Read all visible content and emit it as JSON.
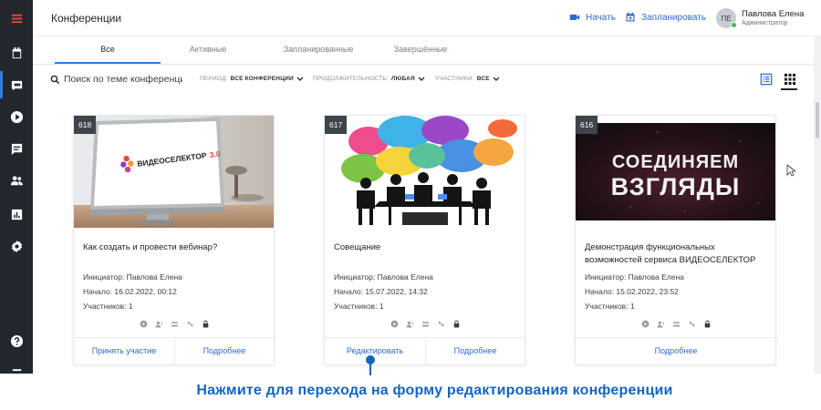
{
  "header": {
    "title": "Конференции",
    "start_label": "Начать",
    "schedule_label": "Запланировать",
    "user": {
      "initials": "ПЕ",
      "name": "Павлова Елена",
      "role": "Администратор",
      "status_color": "#2ebd59"
    }
  },
  "tabs": [
    {
      "label": "Все",
      "active": true
    },
    {
      "label": "Активные",
      "active": false
    },
    {
      "label": "Запланированные",
      "active": false
    },
    {
      "label": "Завершённые",
      "active": false
    }
  ],
  "filters": {
    "search_placeholder": "Поиск по теме конференции",
    "period_label": "ПЕРИОД:",
    "period_value": "ВСЕ КОНФЕРЕНЦИИ",
    "duration_label": "ПРОДОЛЖИТЕЛЬНОСТЬ:",
    "duration_value": "ЛЮБАЯ",
    "participants_label": "УЧАСТНИКИ:",
    "participants_value": "ВСЕ"
  },
  "cards": [
    {
      "id": "618",
      "logo_text": "ВИДЕОСЕЛЕКТОР",
      "logo_version": "3.0",
      "title": "Как создать и провести вебинар?",
      "initiator": "Инициатор: Павлова Елена",
      "start": "Начало: 16.02.2022, 00:12",
      "participants": "Участников: 1",
      "icon_label": "540",
      "primary_action": "Принять участие",
      "secondary_action": "Подробнее"
    },
    {
      "id": "617",
      "title": "Совещание",
      "initiator": "Инициатор: Павлова Елена",
      "start": "Начало: 15.07.2022, 14:32",
      "participants": "Участников: 1",
      "icon_label": "540",
      "primary_action": "Редактировать",
      "secondary_action": "Подробнее"
    },
    {
      "id": "616",
      "image_text_line1": "СОЕДИНЯЕМ",
      "image_text_line2": "ВЗГЛЯДЫ",
      "title": "Демонстрация функциональных возможностей сервиса ВИДЕОСЕЛЕКТОР",
      "initiator": "Инициатор: Павлова Елена",
      "start": "Начало: 15.02.2022, 23:52",
      "participants": "Участников: 1",
      "icon_label": "540",
      "primary_action": "Подробнее"
    }
  ],
  "annotation": {
    "text": "Нажмите для перехода на форму редактирования конференции"
  },
  "colors": {
    "rail_bg": "#22262d",
    "accent": "#2e7de1",
    "link": "#2e6bc7",
    "annotation": "#1565c0",
    "menu_icon": "#e5483d"
  }
}
